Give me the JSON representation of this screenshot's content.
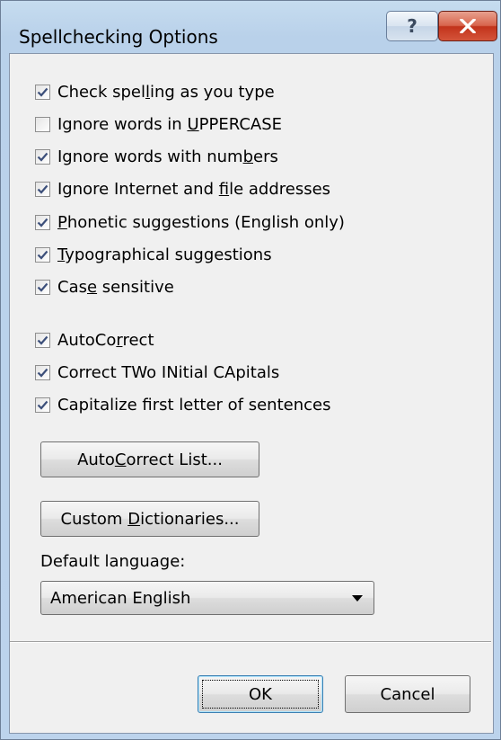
{
  "window": {
    "title": "Spellchecking Options",
    "help_icon": "question-mark-icon",
    "close_icon": "close-x-icon"
  },
  "options": [
    {
      "pre": "Check spel",
      "accel": "l",
      "post": "ing as you type",
      "checked": true
    },
    {
      "pre": "Ignore words in ",
      "accel": "U",
      "post": "PPERCASE",
      "checked": false
    },
    {
      "pre": "Ignore words with num",
      "accel": "b",
      "post": "ers",
      "checked": true
    },
    {
      "pre": "Ignore Internet and ",
      "accel": "f",
      "post": "ile addresses",
      "checked": true
    },
    {
      "pre": "",
      "accel": "P",
      "post": "honetic suggestions (English only)",
      "checked": true
    },
    {
      "pre": "",
      "accel": "T",
      "post": "ypographical suggestions",
      "checked": true
    },
    {
      "pre": "Cas",
      "accel": "e",
      "post": " sensitive",
      "checked": true
    }
  ],
  "autocorrect_options": [
    {
      "pre": "AutoCo",
      "accel": "r",
      "post": "rect",
      "checked": true
    },
    {
      "pre": "Correct TWo INitial CApitals",
      "accel": "",
      "post": "",
      "checked": true
    },
    {
      "pre": "Capitalize first letter of sentences",
      "accel": "",
      "post": "",
      "checked": true
    }
  ],
  "buttons": {
    "autocorrect_list": {
      "pre": "Auto",
      "accel": "C",
      "post": "orrect List..."
    },
    "custom_dictionaries": {
      "pre": "Custom ",
      "accel": "D",
      "post": "ictionaries..."
    },
    "ok": "OK",
    "cancel": "Cancel"
  },
  "default_language": {
    "label": "Default language:",
    "value": "American English"
  }
}
